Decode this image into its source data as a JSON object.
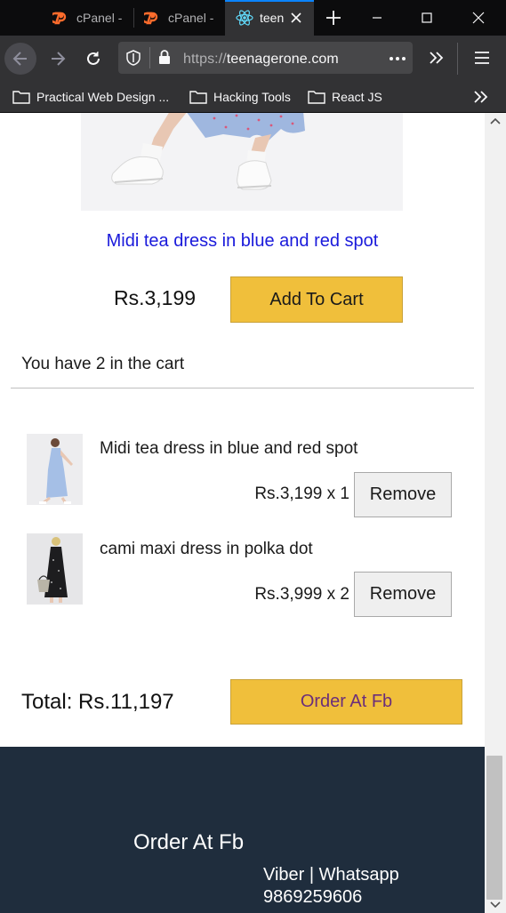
{
  "browser": {
    "tabs": [
      {
        "title": "cPanel -",
        "active": false
      },
      {
        "title": "cPanel -",
        "active": false
      },
      {
        "title": "teen",
        "active": true
      }
    ],
    "url_scheme": "https://",
    "url_host": "teenagerone.com",
    "bookmarks": [
      "Practical Web Design ...",
      "Hacking Tools",
      "React JS"
    ],
    "icons": [
      "back-arrow-icon",
      "forward-arrow-icon",
      "reload-icon",
      "shield-icon",
      "lock-icon",
      "more-dots-icon",
      "overflow-chevron-icon",
      "hamburger-menu-icon",
      "folder-icon",
      "react-icon",
      "cpanel-icon"
    ],
    "accent_color": "#0a84ff"
  },
  "product": {
    "title": "Midi tea dress in blue and red spot",
    "price": "Rs.3,199",
    "add_to_cart_label": "Add To Cart"
  },
  "cart": {
    "summary": "You have 2 in the cart",
    "items": [
      {
        "name": "Midi tea dress in blue and red spot",
        "qty_text": "Rs.3,199 x 1",
        "remove_label": "Remove"
      },
      {
        "name": "cami maxi dress in polka dot",
        "qty_text": "Rs.3,999 x 2",
        "remove_label": "Remove"
      }
    ],
    "total": "Total: Rs.11,197",
    "order_label": "Order At Fb"
  },
  "footer": {
    "title": "Order At Fb",
    "contact_label": "Viber | Whatsapp",
    "phone": "9869259606",
    "background_color": "#1f2d3d"
  },
  "colors": {
    "button_yellow": "#f0bf3b",
    "link_blue": "#1a1adb",
    "order_text": "#6b2e7a"
  }
}
